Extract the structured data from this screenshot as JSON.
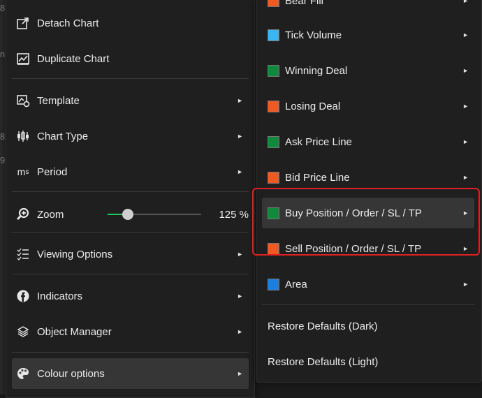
{
  "background": {
    "fragments": [
      "8",
      "n",
      "8",
      "9"
    ]
  },
  "left_menu": {
    "detach": "Detach Chart",
    "duplicate": "Duplicate Chart",
    "template": "Template",
    "chart_type": "Chart Type",
    "period": "Period",
    "zoom": "Zoom",
    "zoom_value": "125 %",
    "zoom_level_percent": 22,
    "viewing_options": "Viewing Options",
    "indicators": "Indicators",
    "object_manager": "Object Manager",
    "colour_options": "Colour options",
    "period_icon_text": "m",
    "period_icon_sub": "s"
  },
  "right_menu": {
    "items": [
      {
        "label": "Bear Fill",
        "color": "#f05a22"
      },
      {
        "label": "Tick Volume",
        "color": "#3ab7f2"
      },
      {
        "label": "Winning Deal",
        "color": "#0f8a3c"
      },
      {
        "label": "Losing Deal",
        "color": "#f05a22"
      },
      {
        "label": "Ask Price Line",
        "color": "#0f8a3c"
      },
      {
        "label": "Bid Price Line",
        "color": "#f05a22"
      },
      {
        "label": "Buy Position / Order / SL / TP",
        "color": "#0f8a3c"
      },
      {
        "label": "Sell Position / Order / SL / TP",
        "color": "#f05a22"
      },
      {
        "label": "Area",
        "color": "#1b7fe0"
      }
    ],
    "restore_dark": "Restore Defaults (Dark)",
    "restore_light": "Restore Defaults (Light)"
  },
  "colors": {
    "accent_green": "#22c55e",
    "highlight_red": "#e02020"
  },
  "arrow_glyph": "►"
}
